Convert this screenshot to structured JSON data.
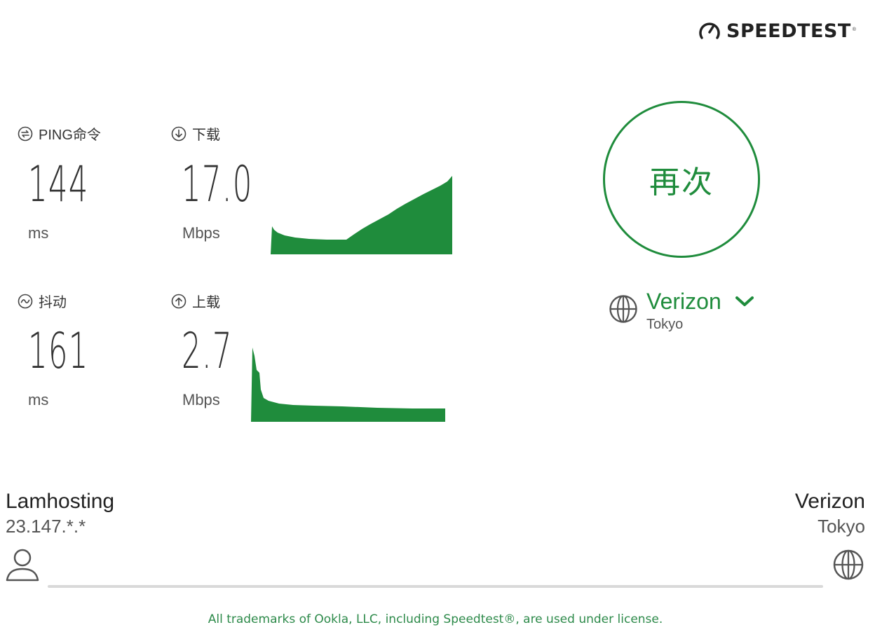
{
  "brand": {
    "logo_text": "SPEEDTEST",
    "reg_mark": "®"
  },
  "colors": {
    "accent": "#1f8c3c",
    "graph_fill": "#1f8c3c",
    "text": "#333333"
  },
  "metrics": {
    "ping": {
      "label": "PING命令",
      "value": "144",
      "unit": "ms",
      "icon": "ping-icon"
    },
    "download": {
      "label": "下载",
      "value": "17.0",
      "unit": "Mbps",
      "icon": "download-arrow-icon"
    },
    "jitter": {
      "label": "抖动",
      "value": "161",
      "unit": "ms",
      "icon": "jitter-wave-icon"
    },
    "upload": {
      "label": "上载",
      "value": "2.7",
      "unit": "Mbps",
      "icon": "upload-arrow-icon"
    }
  },
  "again_button": {
    "label": "再次"
  },
  "server": {
    "name": "Verizon",
    "location": "Tokyo",
    "icon": "globe-icon",
    "dropdown_icon": "chevron-down-icon"
  },
  "connection": {
    "isp": {
      "name": "Lamhosting",
      "ip": "23.147.*.*",
      "icon": "user-icon"
    },
    "host": {
      "name": "Verizon",
      "location": "Tokyo",
      "icon": "globe-icon"
    }
  },
  "footer": {
    "text": "All trademarks of Ookla, LLC, including Speedtest®, are used under license."
  }
}
